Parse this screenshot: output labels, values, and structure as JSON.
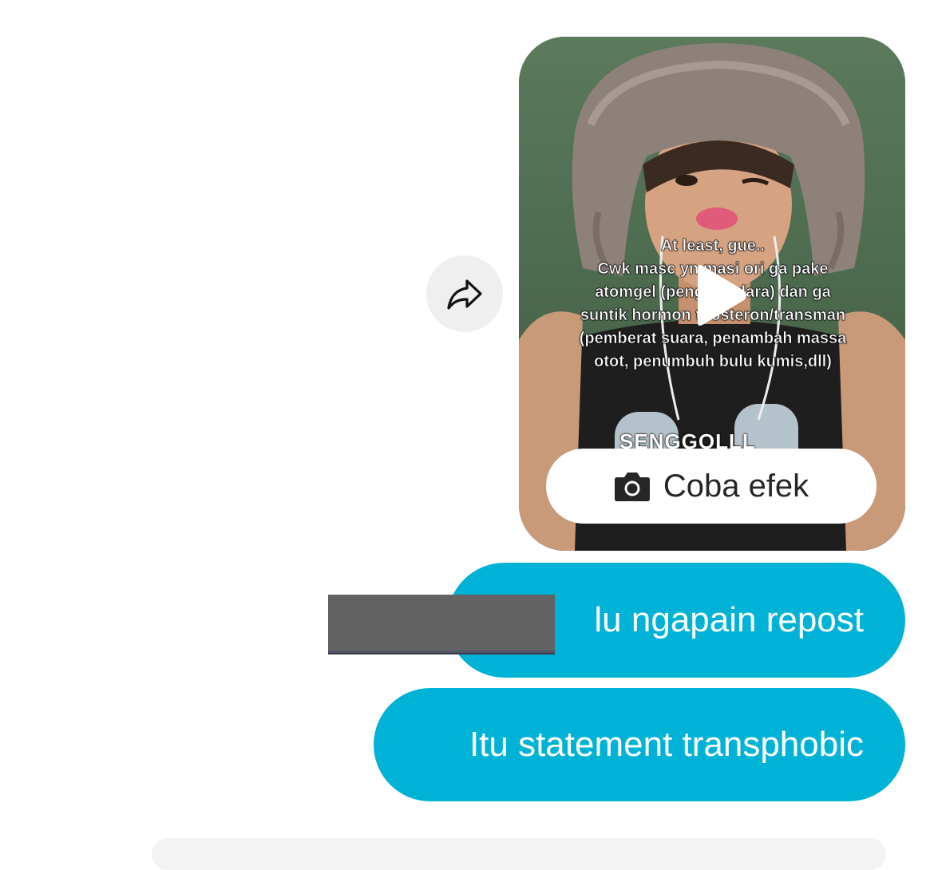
{
  "colors": {
    "bubble_blue": "#00b3d6",
    "share_button_bg": "#efefef",
    "redaction_gray": "#636363"
  },
  "share": {
    "icon": "share-arrow-icon"
  },
  "video": {
    "caption": "At least, gue..\nCwk masc yn  masi ori ga pake\natomgel (penge       yudara) dan ga\nsuntik hormon t  tosteron/transman\n(pemberat suara, penambah massa\notot, penumbuh bulu kumis,dll)",
    "sticker_text": "SENGGOLLL",
    "play_icon": "play-icon",
    "effect_button": {
      "icon": "camera-icon",
      "label": "Coba efek"
    }
  },
  "messages": [
    {
      "text": "lu ngapain repost"
    },
    {
      "text": "Itu statement transphobic"
    }
  ]
}
